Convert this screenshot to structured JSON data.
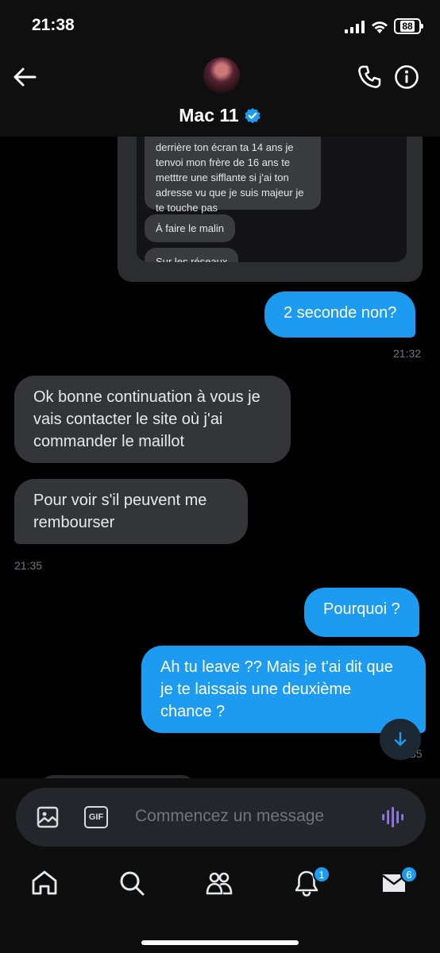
{
  "status_bar": {
    "time": "21:38",
    "battery": "88"
  },
  "header": {
    "name": "Mac 11"
  },
  "quoted_image": {
    "messages": [
      "derrière ton écran ta 14 ans je tenvoi mon frère de 16 ans te metttre une sifflante si j'ai ton adresse vu que je suis majeur je te touche pas",
      "À faire le malin",
      "Sur les réseaux"
    ]
  },
  "messages": [
    {
      "direction": "out",
      "text": "2 seconde non?",
      "time": "21:32"
    },
    {
      "direction": "in",
      "text": "Ok bonne continuation à vous je vais contacter le site où j'ai commander le maillot"
    },
    {
      "direction": "in",
      "text": "Pour voir s'il peuvent me rembourser",
      "time": "21:35"
    },
    {
      "direction": "out",
      "text": "Pourquoi ?"
    },
    {
      "direction": "out",
      "text": "Ah tu leave ?? Mais je t'ai dit que je te laissais une deuxième chance ?",
      "time": "35"
    }
  ],
  "composer": {
    "placeholder": "Commencez un message",
    "gif_label": "GIF"
  },
  "nav": {
    "items": [
      "home-icon",
      "search-icon",
      "communities-icon",
      "notifications-icon",
      "messages-icon"
    ],
    "notifications_badge": "1",
    "messages_badge": "6"
  },
  "colors": {
    "accent": "#1d9bf0",
    "incoming_bubble": "#333538",
    "background": "#000000"
  }
}
